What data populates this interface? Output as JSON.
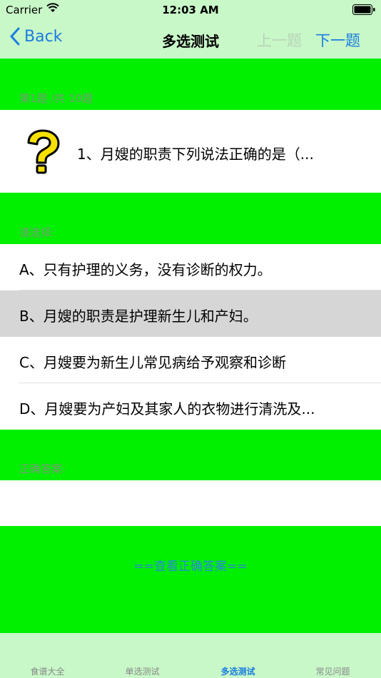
{
  "status_bar": {
    "carrier": "Carrier",
    "time": "12:03 AM"
  },
  "nav": {
    "back_label": "Back",
    "title": "多选测试",
    "prev_label": "上一题",
    "next_label": "下一题"
  },
  "progress": {
    "label": "第1题 /共 10题"
  },
  "question": {
    "text": "1、月嫂的职责下列说法正确的是（..."
  },
  "choose_label": "请选择:",
  "options": [
    {
      "text": "A、只有护理的义务，没有诊断的权力。",
      "selected": false
    },
    {
      "text": "B、月嫂的职责是护理新生儿和产妇。",
      "selected": true
    },
    {
      "text": "C、月嫂要为新生儿常见病给予观察和诊断",
      "selected": false
    },
    {
      "text": "D、月嫂要为产妇及其家人的衣物进行清洗及...",
      "selected": false
    }
  ],
  "answer_label": "正确答案:",
  "show_answer_label": "==查看正确答案==",
  "tabs": [
    {
      "label": "食谱大全",
      "active": false
    },
    {
      "label": "单选测试",
      "active": false
    },
    {
      "label": "多选测试",
      "active": true
    },
    {
      "label": "常见问题",
      "active": false
    }
  ],
  "colors": {
    "accent": "#1a7de0",
    "band": "#00f000",
    "bar": "#c8f7c8",
    "selected": "#d6d6d6"
  }
}
